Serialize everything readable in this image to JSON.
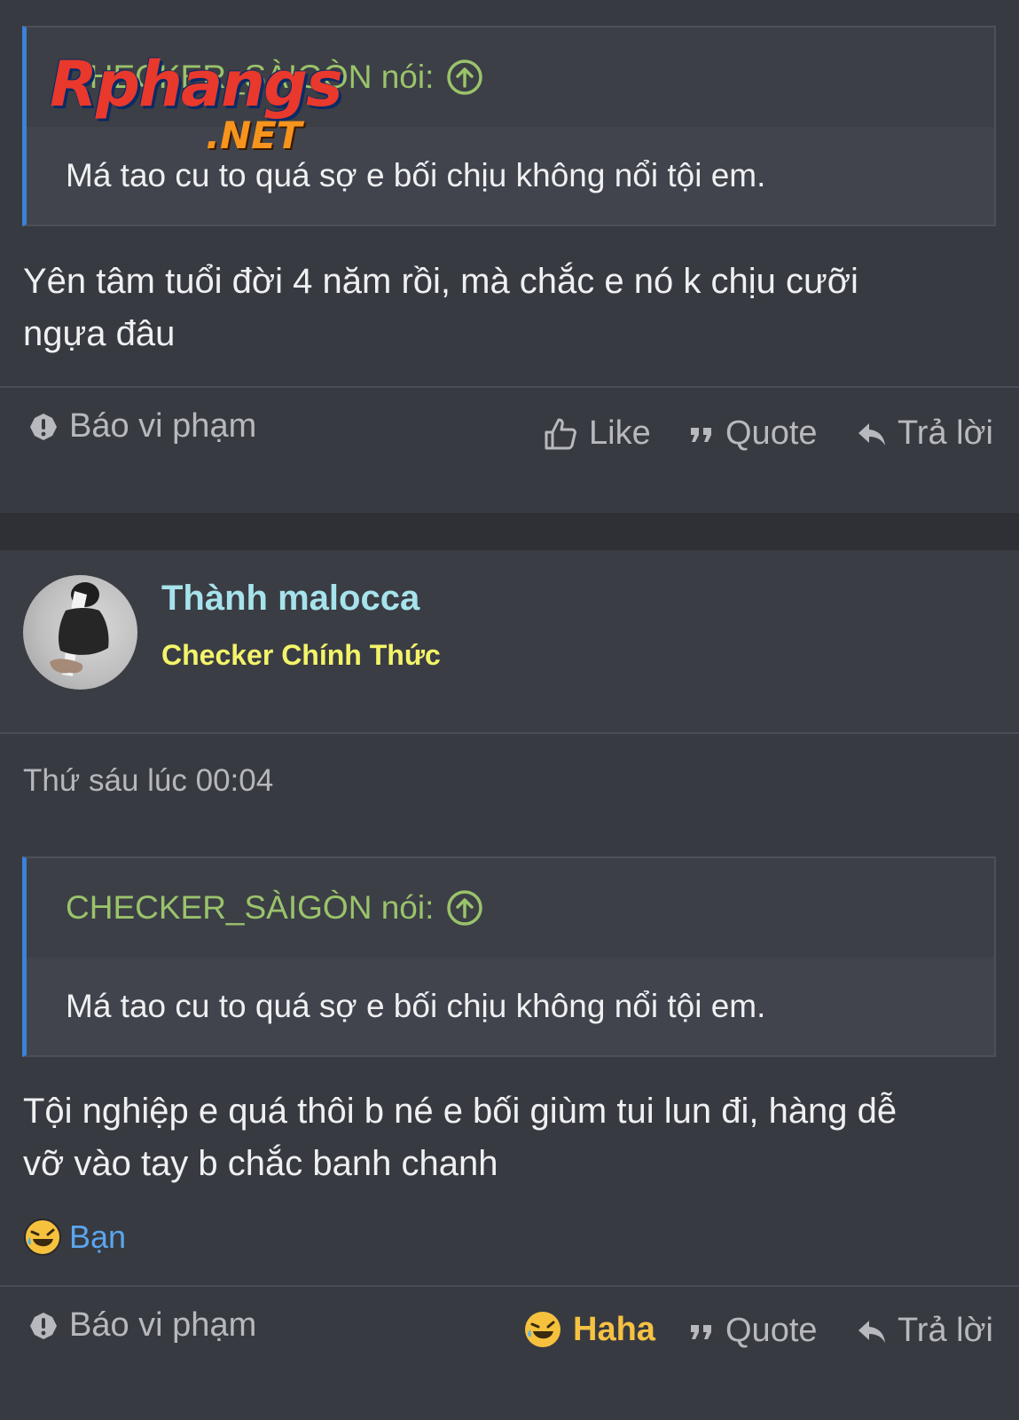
{
  "post1": {
    "quote": {
      "author": "CHECKER_SÀIGÒN nói:",
      "text": "Má tao cu to quá sợ e bối chịu không nổi tội em."
    },
    "message_line1": "Yên tâm tuổi đời 4 năm rồi, mà chắc e nó k chịu cưỡi",
    "message_line2": "ngựa đâu",
    "actions": {
      "report": "Báo vi phạm",
      "like": "Like",
      "quote": "Quote",
      "reply": "Trả lời"
    }
  },
  "post2": {
    "author": {
      "name": "Thành malocca",
      "title": "Checker Chính Thức"
    },
    "time": "Thứ sáu lúc 00:04",
    "quote": {
      "author": "CHECKER_SÀIGÒN nói:",
      "text": "Má tao cu to quá sợ e bối chịu không nổi tội em."
    },
    "message_line1": "Tội nghiệp e quá thôi b né e bối giùm tui lun đi, hàng dễ",
    "message_line2": "vỡ vào tay b chắc banh chanh",
    "reaction": {
      "icon": "laughing-emoji-icon",
      "label": "Bạn"
    },
    "actions": {
      "report": "Báo vi phạm",
      "haha": "Haha",
      "quote": "Quote",
      "reply": "Trả lời"
    }
  },
  "watermark": {
    "main": "Rphangs",
    "sub": ".NET"
  },
  "colors": {
    "background": "#2e3035",
    "post_bg": "#383a41",
    "quote_border": "#3b82d8",
    "quote_author": "#9ac36b",
    "author_name": "#a6e3ec",
    "author_title": "#f4f46a",
    "reaction_label": "#5aa6ee",
    "haha": "#f5c242"
  }
}
